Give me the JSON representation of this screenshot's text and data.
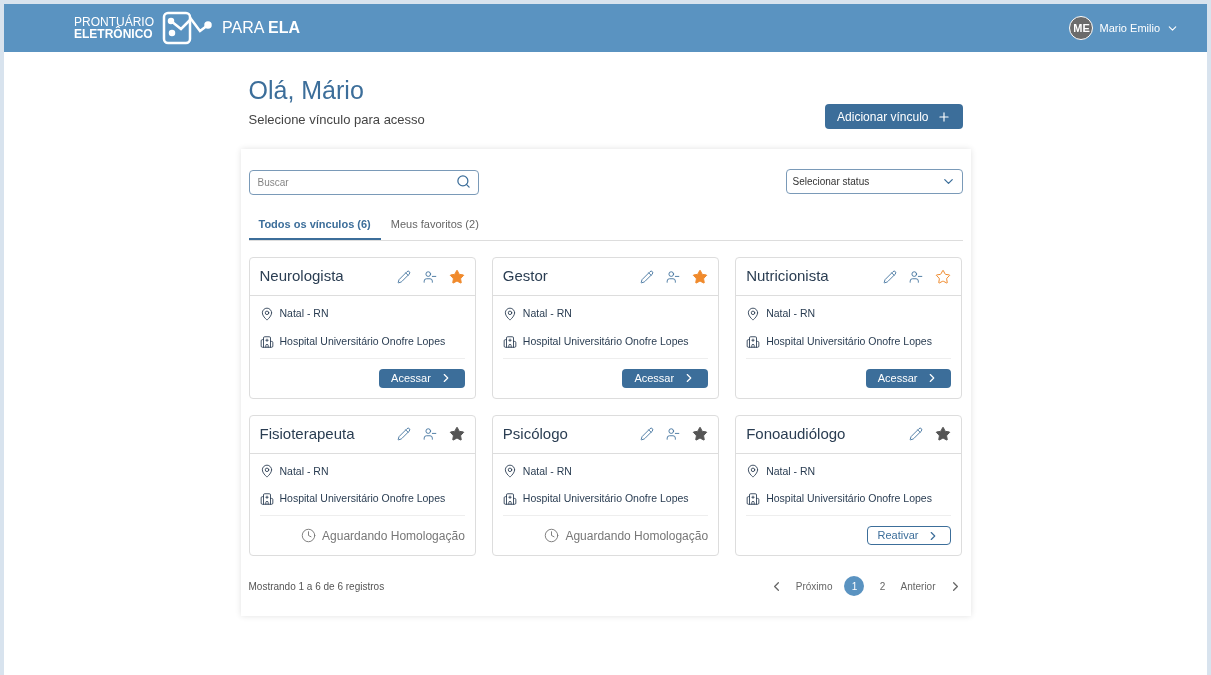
{
  "header": {
    "logo_top": "PRONTUÁRIO",
    "logo_bottom": "ELETRÔNICO",
    "brand_light": "PARA",
    "brand_bold": "ELA",
    "avatar": "ME",
    "user_name": "Mario Emilio"
  },
  "greeting": "Olá, Mário",
  "subtitle": "Selecione vínculo para acesso",
  "add_button": "Adicionar vínculo",
  "search": {
    "placeholder": "Buscar"
  },
  "status_select": {
    "value": "Selecionar status"
  },
  "tabs": [
    {
      "label": "Todos os vínculos (6)",
      "selected": true
    },
    {
      "label": "Meus favoritos (2)",
      "selected": false
    }
  ],
  "cards": [
    {
      "title": "Neurologista",
      "can_unlink": true,
      "starred": true,
      "active": true,
      "location": "Natal - RN",
      "hospital": "Hospital Universitário Onofre Lopes",
      "footer": {
        "kind": "access",
        "label": "Acessar"
      }
    },
    {
      "title": "Gestor",
      "can_unlink": true,
      "starred": true,
      "active": true,
      "location": "Natal - RN",
      "hospital": "Hospital Universitário Onofre Lopes",
      "footer": {
        "kind": "access",
        "label": "Acessar"
      }
    },
    {
      "title": "Nutricionista",
      "can_unlink": true,
      "starred": false,
      "active": true,
      "location": "Natal - RN",
      "hospital": "Hospital Universitário Onofre Lopes",
      "footer": {
        "kind": "access",
        "label": "Acessar"
      }
    },
    {
      "title": "Fisioterapeuta",
      "can_unlink": true,
      "starred": true,
      "active": false,
      "location": "Natal - RN",
      "hospital": "Hospital Universitário Onofre Lopes",
      "footer": {
        "kind": "pending",
        "label": "Aguardando Homologação"
      }
    },
    {
      "title": "Psicólogo",
      "can_unlink": true,
      "starred": true,
      "active": false,
      "location": "Natal - RN",
      "hospital": "Hospital Universitário Onofre Lopes",
      "footer": {
        "kind": "pending",
        "label": "Aguardando Homologação"
      }
    },
    {
      "title": "Fonoaudiólogo",
      "can_unlink": false,
      "starred": true,
      "active": false,
      "location": "Natal - RN",
      "hospital": "Hospital Universitário Onofre Lopes",
      "footer": {
        "kind": "reactivate",
        "label": "Reativar"
      }
    }
  ],
  "records_info": "Mostrando 1 a 6 de 6 registros",
  "pagination": {
    "next": "Próximo",
    "previous": "Anterior",
    "pages": [
      {
        "label": "1",
        "selected": true
      },
      {
        "label": "2",
        "selected": false
      }
    ]
  }
}
